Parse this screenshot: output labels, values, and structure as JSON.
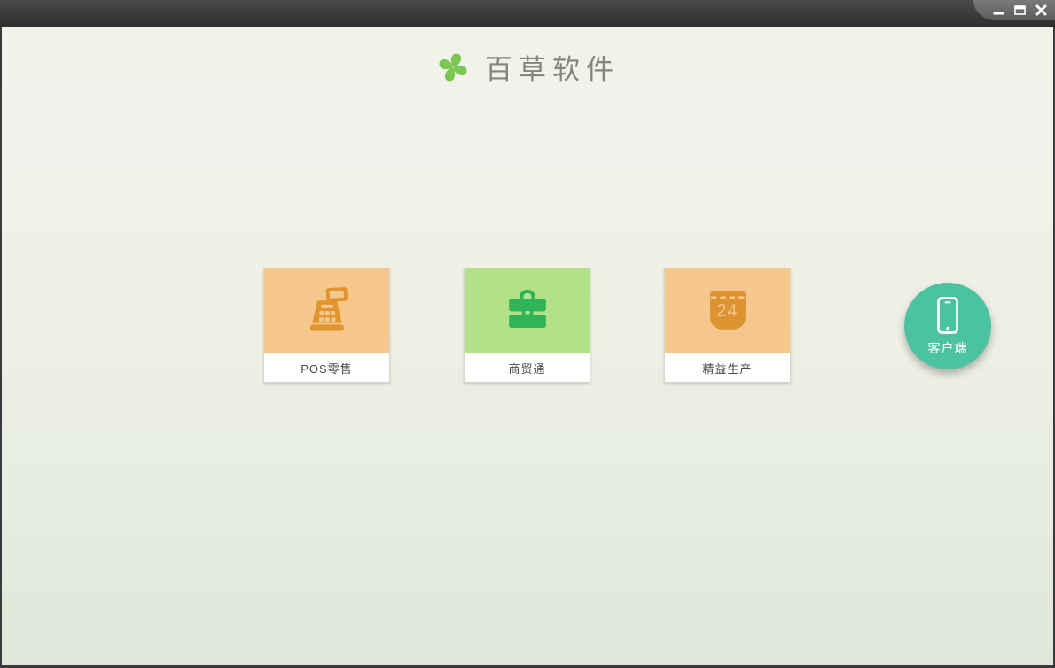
{
  "window": {
    "controls": {
      "minimize": "minimize",
      "maximize": "maximize",
      "close": "close"
    }
  },
  "header": {
    "title": "百草软件",
    "logo": {
      "name": "pinwheel-logo",
      "petal_colors": [
        "#7cc653",
        "#f0a33c",
        "#5aa7e0",
        "#ed7047"
      ]
    }
  },
  "products": [
    {
      "label": "POS零售",
      "icon": "cash-register-icon",
      "bg_color": "#f6c78d",
      "icon_color": "#e0952f"
    },
    {
      "label": "商贸通",
      "icon": "briefcase-icon",
      "bg_color": "#b3e189",
      "icon_color": "#2fb457"
    },
    {
      "label": "精益生产",
      "icon": "calendar-icon",
      "bg_color": "#f6c78d",
      "icon_color": "#dd9430",
      "calendar_day": "24"
    }
  ],
  "client_button": {
    "label": "客户端",
    "icon": "smartphone-icon",
    "bg_color": "#4cc3a0"
  },
  "colors": {
    "titlebar": "#3a3a3a",
    "content_top": "#f2f1ea",
    "content_bottom": "#dfe7d9",
    "accent_teal": "#4cc3a0"
  }
}
